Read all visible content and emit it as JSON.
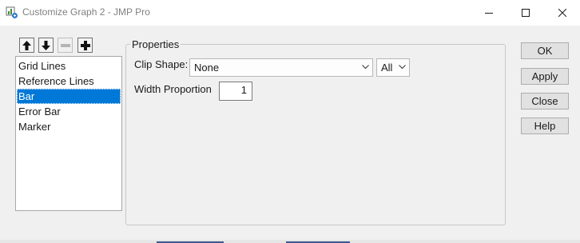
{
  "window": {
    "title": "Customize Graph 2 - JMP Pro",
    "icons": {
      "app": "jmp-app-icon",
      "minimize": "minimize-icon",
      "maximize": "maximize-icon",
      "close": "close-icon"
    }
  },
  "toolbar": {
    "icons": [
      "arrow-up-icon",
      "arrow-down-icon",
      "minus-icon",
      "plus-icon"
    ],
    "remove_enabled": false
  },
  "list": {
    "items": [
      "Grid Lines",
      "Reference Lines",
      "Bar",
      "Error Bar",
      "Marker"
    ],
    "selected": "Bar"
  },
  "properties": {
    "legend": "Properties",
    "clip_shape": {
      "label": "Clip Shape:",
      "value": "None",
      "scope": "All"
    },
    "width_proportion": {
      "label": "Width Proportion",
      "value": "1"
    }
  },
  "buttons": {
    "ok": "OK",
    "apply": "Apply",
    "close": "Close",
    "help": "Help"
  },
  "colors": {
    "selection": "#0078d7",
    "title_text": "#808080",
    "button_face": "#e1e1e1"
  }
}
